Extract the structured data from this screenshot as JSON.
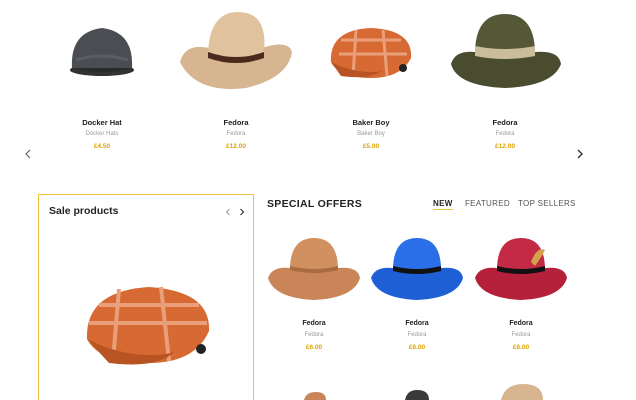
{
  "carousel": {
    "items": [
      {
        "name": "Docker Hat",
        "category": "Docker Hats",
        "price": "£4.50"
      },
      {
        "name": "Fedora",
        "category": "Fedora",
        "price": "£12.00"
      },
      {
        "name": "Baker Boy",
        "category": "Baker Boy",
        "price": "£5.00"
      },
      {
        "name": "Fedora",
        "category": "Fedora",
        "price": "£12.00"
      }
    ],
    "prev_icon": "chevron-left-icon",
    "next_icon": "chevron-right-icon"
  },
  "sale": {
    "title": "Sale products"
  },
  "offers": {
    "title": "SPECIAL OFFERS",
    "tabs": [
      "NEW",
      "FEATURED",
      "TOP SELLERS"
    ],
    "active_tab": "NEW",
    "items": [
      {
        "name": "Fedora",
        "category": "Fedora",
        "price": "£6.00"
      },
      {
        "name": "Fedora",
        "category": "Fedora",
        "price": "£6.00"
      },
      {
        "name": "Fedora",
        "category": "Fedora",
        "price": "£6.00"
      }
    ]
  },
  "colors": {
    "accent": "#f0c43a",
    "price": "#e0a200"
  }
}
